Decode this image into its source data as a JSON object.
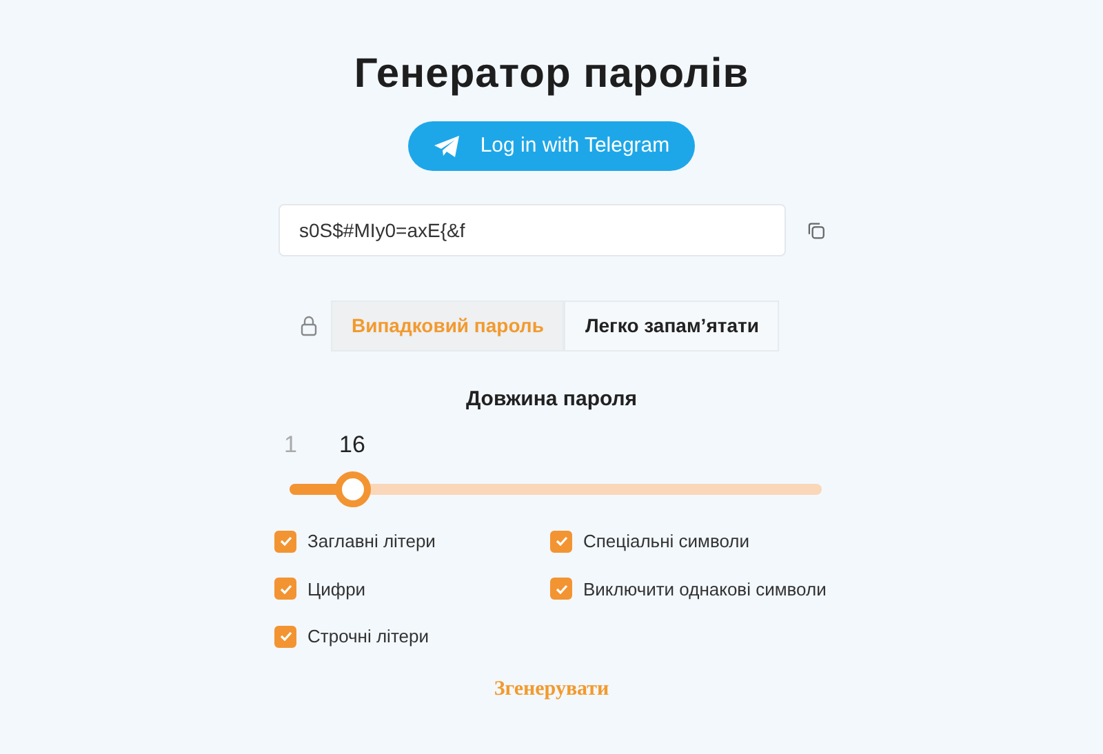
{
  "title": "Генератор паролів",
  "telegram_button": {
    "label": "Log in with Telegram"
  },
  "password_field": {
    "value": "s0S$#MIy0=axE{&f"
  },
  "tabs": [
    {
      "label": "Випадковий пароль",
      "selected": true
    },
    {
      "label": "Легко запам’ятати",
      "selected": false
    }
  ],
  "length": {
    "label": "Довжина пароля",
    "min": "1",
    "value": "16",
    "level": 0.12
  },
  "options": [
    {
      "label": "Заглавні літери",
      "checked": true
    },
    {
      "label": "Спеціальні символи",
      "checked": true
    },
    {
      "label": "Цифри",
      "checked": true
    },
    {
      "label": "Виключити однакові символи",
      "checked": true
    },
    {
      "label": "Строчні літери",
      "checked": true
    }
  ],
  "generate_button": {
    "label": "Згенерувати"
  }
}
